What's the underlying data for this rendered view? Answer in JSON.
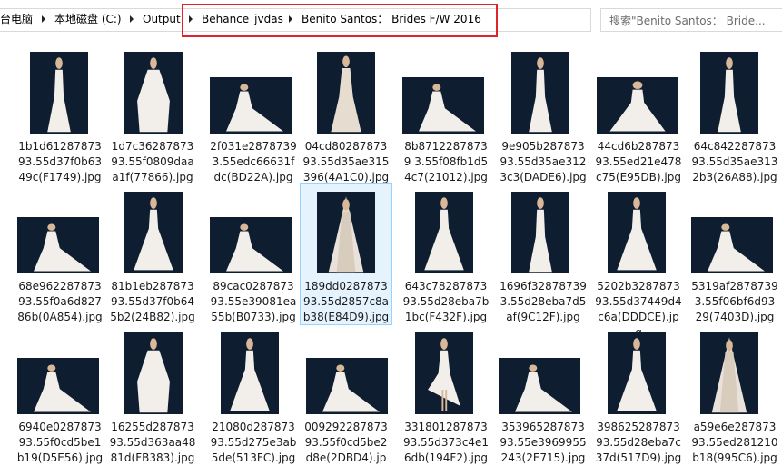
{
  "address_bar": {
    "crumbs": [
      "台电脑",
      "本地磁盘 (C:)",
      "Output",
      "Behance_jvdas",
      "Benito Santos： Brides F/W 2016"
    ]
  },
  "search": {
    "placeholder": "搜索\"Benito Santos： Bride..."
  },
  "files": [
    {
      "name": "1b1d6128787393.55d37f0b6349c(F1749).jpg",
      "dress": "mermaid",
      "selected": false
    },
    {
      "name": "1d7c3628787393.55f0809daaa1f(77866).jpg",
      "dress": "cape",
      "selected": false
    },
    {
      "name": "2f031e28787393.55edc66631fdc(BD22A).jpg",
      "dress": "train",
      "selected": false
    },
    {
      "name": "04cd8028787393.55d35ae315396(4A1C0).jpg",
      "dress": "lace",
      "selected": false
    },
    {
      "name": "8b87122878739 3.55f08fb1d54c7(21012).jpg",
      "dress": "train",
      "selected": false
    },
    {
      "name": "9e905b28787393.55d35ae3123c3(DADE6).jpg",
      "dress": "mermaid",
      "selected": false
    },
    {
      "name": "44cd6b28787393.55ed21e478c75(E95DB).jpg",
      "dress": "ballgown",
      "selected": false
    },
    {
      "name": "64c842287873 93.55d35ae3132b3(26A88).jpg",
      "dress": "mermaid",
      "selected": false
    },
    {
      "name": "68e96228787393.55f0a6d82786b(0A854).jpg",
      "dress": "train",
      "selected": false
    },
    {
      "name": "81b1eb28787393.55d37f0b645b2(24B82).jpg",
      "dress": "ballgown",
      "selected": false
    },
    {
      "name": "89cac028787393.55e39081ea55b(B0733).jpg",
      "dress": "train",
      "selected": false
    },
    {
      "name": "189dd028787393.55d2857c8ab38(E84D9).jpg",
      "dress": "veil",
      "selected": true
    },
    {
      "name": "643c78287873 93.55d28eba7b1bc(F432F).jpg",
      "dress": "ballgown",
      "selected": false
    },
    {
      "name": "1696f328787393.55d28eba7d5af(9C12F).jpg",
      "dress": "mermaid",
      "selected": false
    },
    {
      "name": "5202b328787393.55d37449d4c6a(DDDCE).jpg",
      "dress": "ballgown",
      "selected": false
    },
    {
      "name": "5319af28787393.55f06bf6d9329(7403D).jpg",
      "dress": "train",
      "selected": false
    },
    {
      "name": "6940e028787393.55f0cd5be1b19(D5E56).jpg",
      "dress": "train",
      "selected": false
    },
    {
      "name": "16255d28787393.55d363aa4881d(FB383).jpg",
      "dress": "cape",
      "selected": false
    },
    {
      "name": "21080d28787393.55d275e3ab5de(513FC).jpg",
      "dress": "ballgown",
      "selected": false
    },
    {
      "name": "009292287873 93.55f0cd5be2d8e(2DBD4).jpg",
      "dress": "train",
      "selected": false
    },
    {
      "name": "331801287873 93.55d373c4e16db(194F2).jpg",
      "dress": "highlow",
      "selected": false
    },
    {
      "name": "353965287873 93.55e3969955243(2E715).jpg",
      "dress": "train",
      "selected": false
    },
    {
      "name": "398625287873 93.55d28eba7c37d(517D9).jpg",
      "dress": "ballgown",
      "selected": false
    },
    {
      "name": "a59e6e28787393.55ed281210b18(995C6).jpg",
      "dress": "veil",
      "selected": false
    }
  ],
  "colors": {
    "thumb_bg": "#0e1d2f",
    "dress": "#f2eeea",
    "highlight": "#e0242c",
    "selected_bg": "#e5f3ff"
  }
}
